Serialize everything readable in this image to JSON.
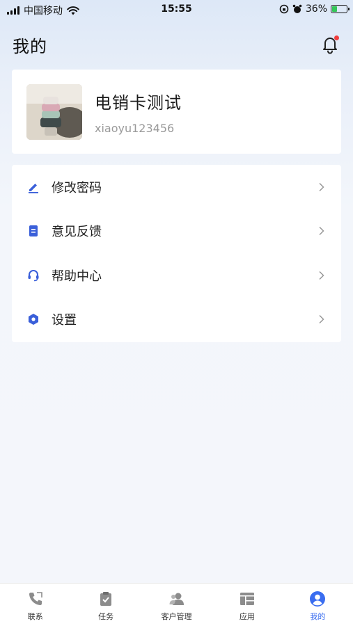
{
  "status_bar": {
    "carrier": "中国移动",
    "time": "15:55",
    "battery_percent": "36%",
    "battery_level": 0.36
  },
  "header": {
    "title": "我的",
    "bell_icon": "bell-icon",
    "has_notification": true
  },
  "profile": {
    "name": "电销卡测试",
    "user_id": "xiaoyu123456"
  },
  "menu": {
    "items": [
      {
        "label": "修改密码",
        "icon": "edit-icon"
      },
      {
        "label": "意见反馈",
        "icon": "document-icon"
      },
      {
        "label": "帮助中心",
        "icon": "headset-icon"
      },
      {
        "label": "设置",
        "icon": "settings-icon"
      }
    ]
  },
  "tabbar": {
    "tabs": [
      {
        "label": "联系",
        "icon": "phone-icon"
      },
      {
        "label": "任务",
        "icon": "clipboard-icon"
      },
      {
        "label": "客户管理",
        "icon": "users-icon"
      },
      {
        "label": "应用",
        "icon": "grid-icon"
      },
      {
        "label": "我的",
        "icon": "user-icon",
        "active": true
      }
    ]
  },
  "colors": {
    "accent": "#3a6df0",
    "badge": "#f03e3e"
  }
}
